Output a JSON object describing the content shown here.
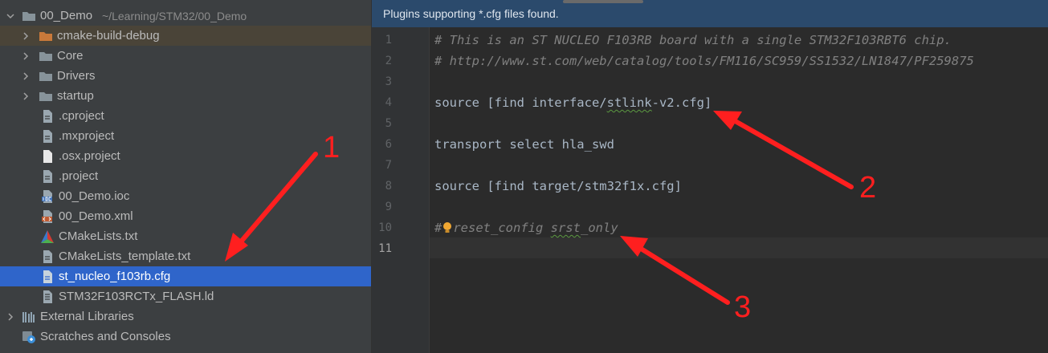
{
  "tree": {
    "root": {
      "name": "00_Demo",
      "path": "~/Learning/STM32/00_Demo"
    },
    "items": [
      {
        "label": "cmake-build-debug",
        "type": "folder-orange"
      },
      {
        "label": "Core",
        "type": "folder"
      },
      {
        "label": "Drivers",
        "type": "folder"
      },
      {
        "label": "startup",
        "type": "folder"
      },
      {
        "label": ".cproject",
        "type": "file"
      },
      {
        "label": ".mxproject",
        "type": "file"
      },
      {
        "label": ".osx.project",
        "type": "file-white"
      },
      {
        "label": ".project",
        "type": "file"
      },
      {
        "label": "00_Demo.ioc",
        "type": "ioc"
      },
      {
        "label": "00_Demo.xml",
        "type": "xml"
      },
      {
        "label": "CMakeLists.txt",
        "type": "cmake"
      },
      {
        "label": "CMakeLists_template.txt",
        "type": "file"
      },
      {
        "label": "st_nucleo_f103rb.cfg",
        "type": "file",
        "selected": true
      },
      {
        "label": "STM32F103RCTx_FLASH.ld",
        "type": "ld"
      }
    ],
    "external_libraries": "External Libraries",
    "scratches": "Scratches and Consoles"
  },
  "editor": {
    "banner": "Plugins supporting *.cfg files found.",
    "line_numbers": [
      "1",
      "2",
      "3",
      "4",
      "5",
      "6",
      "7",
      "8",
      "9",
      "10",
      "11"
    ],
    "lines": {
      "l1": "# This is an ST NUCLEO F103RB board with a single STM32F103RBT6 chip.",
      "l2": "# http://www.st.com/web/catalog/tools/FM116/SC959/SS1532/LN1847/PF259875",
      "l4a": "source [find interface/",
      "l4b": "stlink",
      "l4c": "-v2.cfg]",
      "l6": "transport select hla_swd",
      "l8": "source [find target/stm32f1x.cfg]",
      "l10a": "#",
      "l10b": "reset_config ",
      "l10c": "srst",
      "l10d": "_only"
    }
  },
  "annotations": {
    "n1": "1",
    "n2": "2",
    "n3": "3",
    "color": "#ff1f1f"
  },
  "colors": {
    "selection": "#2f65ca",
    "banner": "#2b4a6c",
    "comment": "#808080",
    "code": "#a9b7c6"
  }
}
